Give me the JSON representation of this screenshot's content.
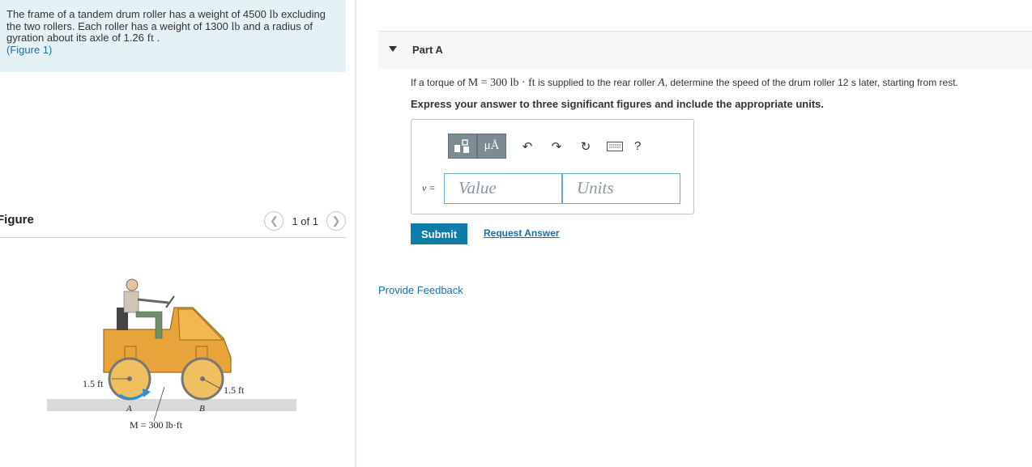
{
  "problem": {
    "text_1": "The frame of a tandem drum roller has a weight of 4500",
    "unit_lb_1": "lb",
    "text_2": "excluding",
    "text_3": "the two rollers. Each roller has a weight of 1300",
    "unit_lb_2": "lb",
    "text_4": "and a radius of",
    "text_5": "gyration about its axle of 1.26",
    "unit_ft": "ft",
    "text_6": ".",
    "figure_link": "(Figure 1)"
  },
  "figure": {
    "title": "Figure",
    "pager_text": "1 of 1",
    "prev_icon": "chevron-left-icon",
    "next_icon": "chevron-right-icon",
    "label_left_radius": "1.5 ft",
    "label_right_radius": "1.5 ft",
    "label_A": "A",
    "label_B": "B",
    "label_moment": "M = 300 lb·ft"
  },
  "part": {
    "title": "Part A",
    "question_prefix": "If a torque of",
    "question_math": "M = 300 lb · ft",
    "question_mid": "is supplied to the rear roller",
    "question_var": "A",
    "question_suffix": ", determine the speed of the drum roller 12 s later, starting from rest.",
    "instruction": "Express your answer to three significant figures and include the appropriate units."
  },
  "answer": {
    "var_label": "v =",
    "value_placeholder": "Value",
    "units_placeholder": "Units",
    "units_button_label": "μÅ",
    "help_label": "?"
  },
  "actions": {
    "submit": "Submit",
    "request_answer": "Request Answer",
    "feedback": "Provide Feedback"
  },
  "colors": {
    "problem_bg": "#e4f2f6",
    "link": "#1c6fa6",
    "submit_bg": "#0e7ca8",
    "toolbar_button": "#7d8b93"
  }
}
